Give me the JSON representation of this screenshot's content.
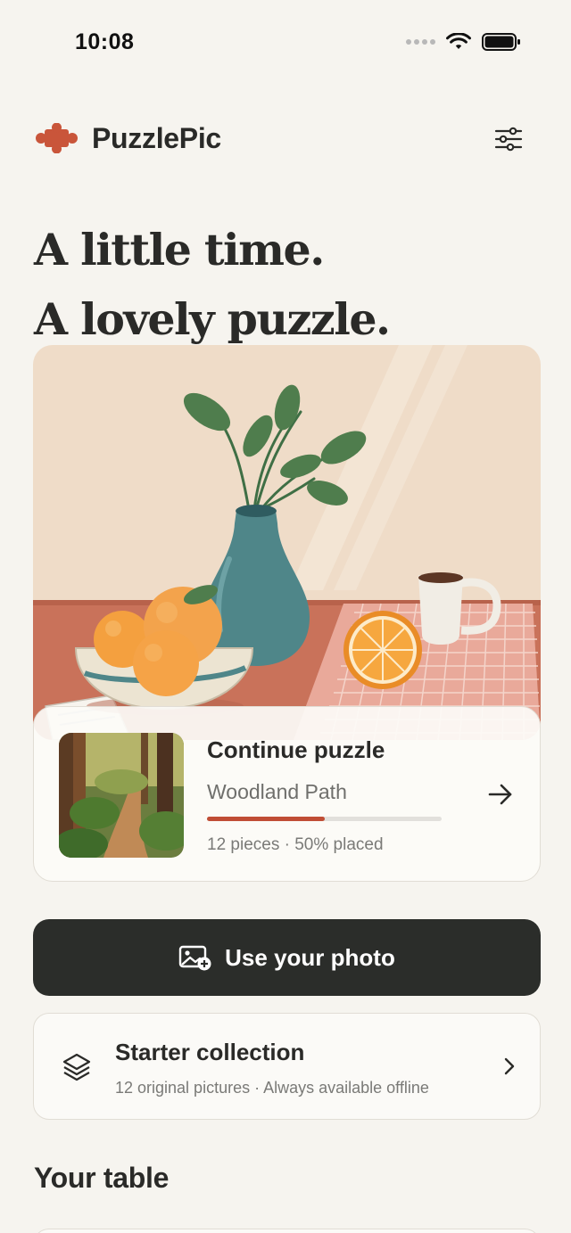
{
  "status_bar": {
    "time": "10:08"
  },
  "header": {
    "app_name": "PuzzlePic"
  },
  "headline": {
    "line1": "A little time.",
    "line2": "A lovely puzzle."
  },
  "continue_card": {
    "title": "Continue puzzle",
    "puzzle_name": "Woodland Path",
    "meta": "12 pieces · 50% placed",
    "progress": 0.5
  },
  "photo_button": {
    "label": "Use your photo",
    "icon": "add-photo-icon"
  },
  "starter": {
    "title": "Starter collection",
    "subtitle": "12 original pictures · Always available offline",
    "icon": "layers-icon"
  },
  "section": {
    "title": "Your table"
  },
  "colors": {
    "accent": "#c04d35",
    "background": "#f6f4ef",
    "dark_button": "#2b2d2a",
    "text": "#2a2a28"
  }
}
